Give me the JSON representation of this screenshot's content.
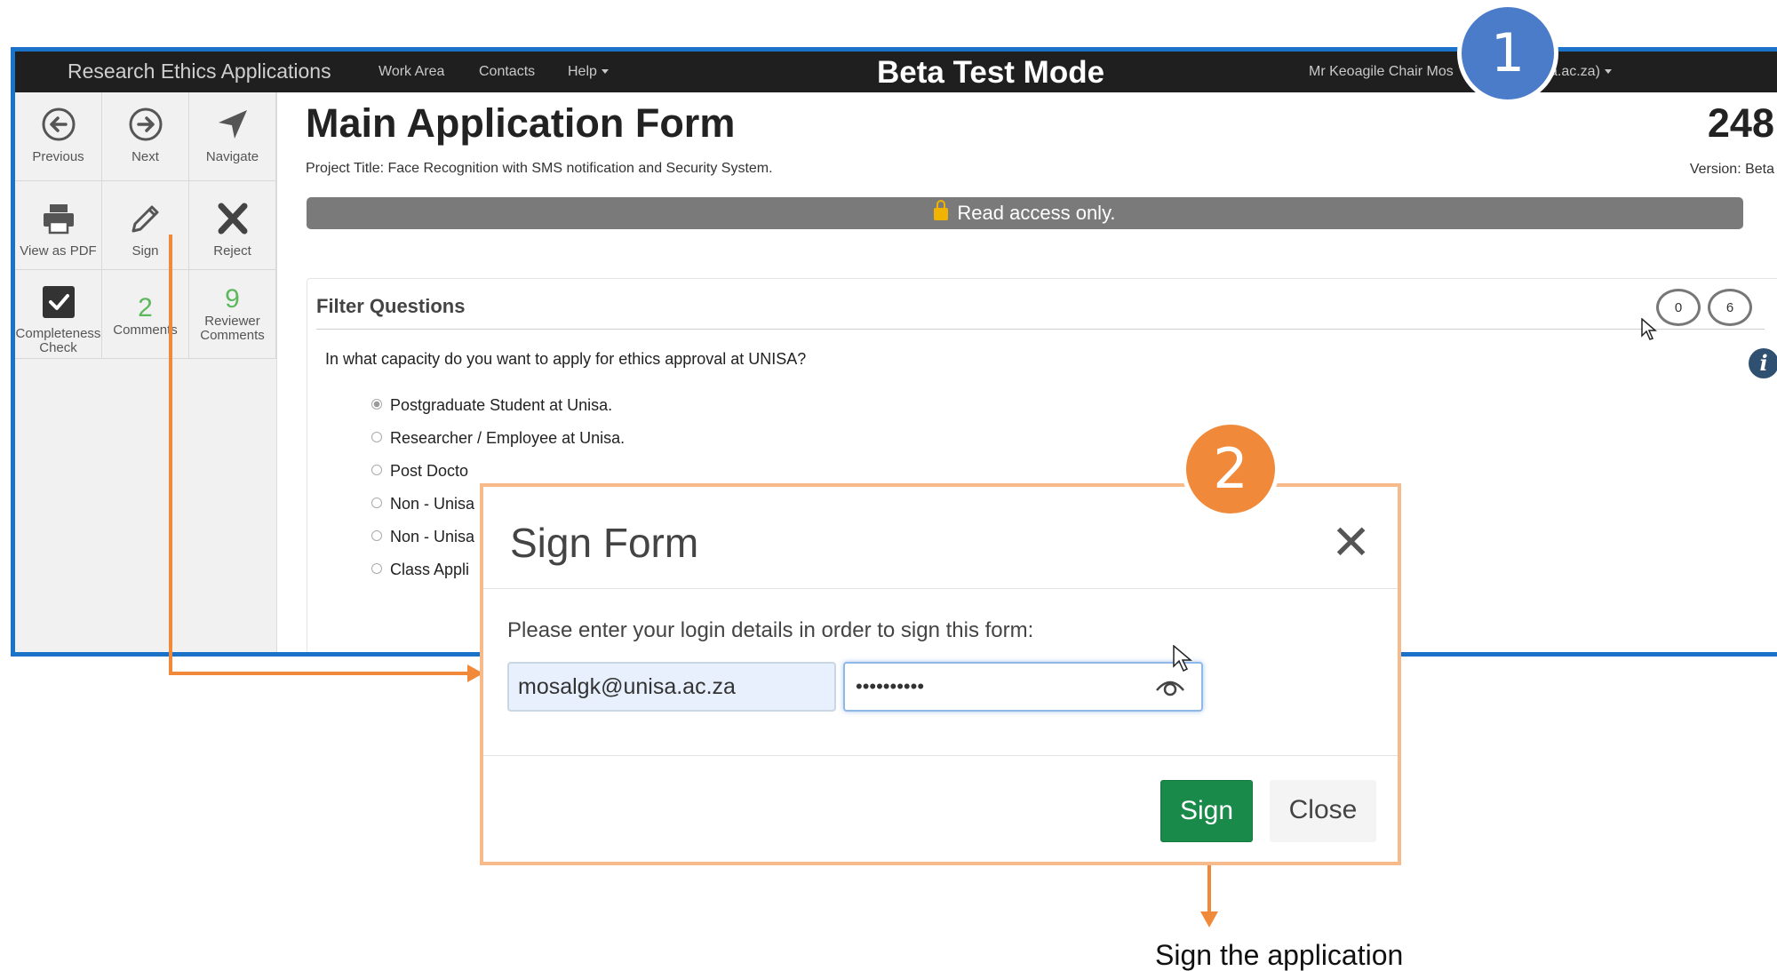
{
  "navbar": {
    "brand": "Research Ethics Applications",
    "links": [
      "Work Area",
      "Contacts",
      "Help"
    ],
    "mode_title": "Beta Test Mode",
    "user": "Mr Keoagile Chair Mos",
    "user_email_fragment": "unisa.ac.za)"
  },
  "sidebar": {
    "previous": "Previous",
    "next": "Next",
    "navigate": "Navigate",
    "view_pdf": "View as PDF",
    "sign": "Sign",
    "reject": "Reject",
    "completeness_line1": "Completeness",
    "completeness_line2": "Check",
    "comments_count": "2",
    "comments": "Comments",
    "reviewer_count": "9",
    "reviewer_line1": "Reviewer",
    "reviewer_line2": "Comments"
  },
  "main": {
    "title": "Main Application Form",
    "project_title": "Project Title: Face Recognition with SMS notification and Security System.",
    "form_number": "248",
    "version": "Version: Beta",
    "read_access": "Read access only."
  },
  "panel": {
    "heading": "Filter Questions",
    "bubble_left": "0",
    "bubble_right": "6",
    "info_icon": "i",
    "question": "In what capacity do you want to apply for ethics approval at UNISA?",
    "options": [
      "Postgraduate Student at Unisa.",
      "Researcher / Employee at Unisa.",
      "Post Docto",
      "Non - Unisa",
      "Non - Unisa",
      "Class Appli"
    ]
  },
  "badges": {
    "one": "1",
    "two": "2"
  },
  "modal": {
    "title": "Sign Form",
    "close_symbol": "✕",
    "prompt": "Please enter your login details in order to sign this form:",
    "username_value": "mosalgk@unisa.ac.za",
    "password_value": "••••••••••",
    "sign_label": "Sign",
    "close_label": "Close"
  },
  "annotation": {
    "caption": "Sign the application",
    "arrow_color": "#f08a3a",
    "accent_blue": "#1a73c8"
  }
}
